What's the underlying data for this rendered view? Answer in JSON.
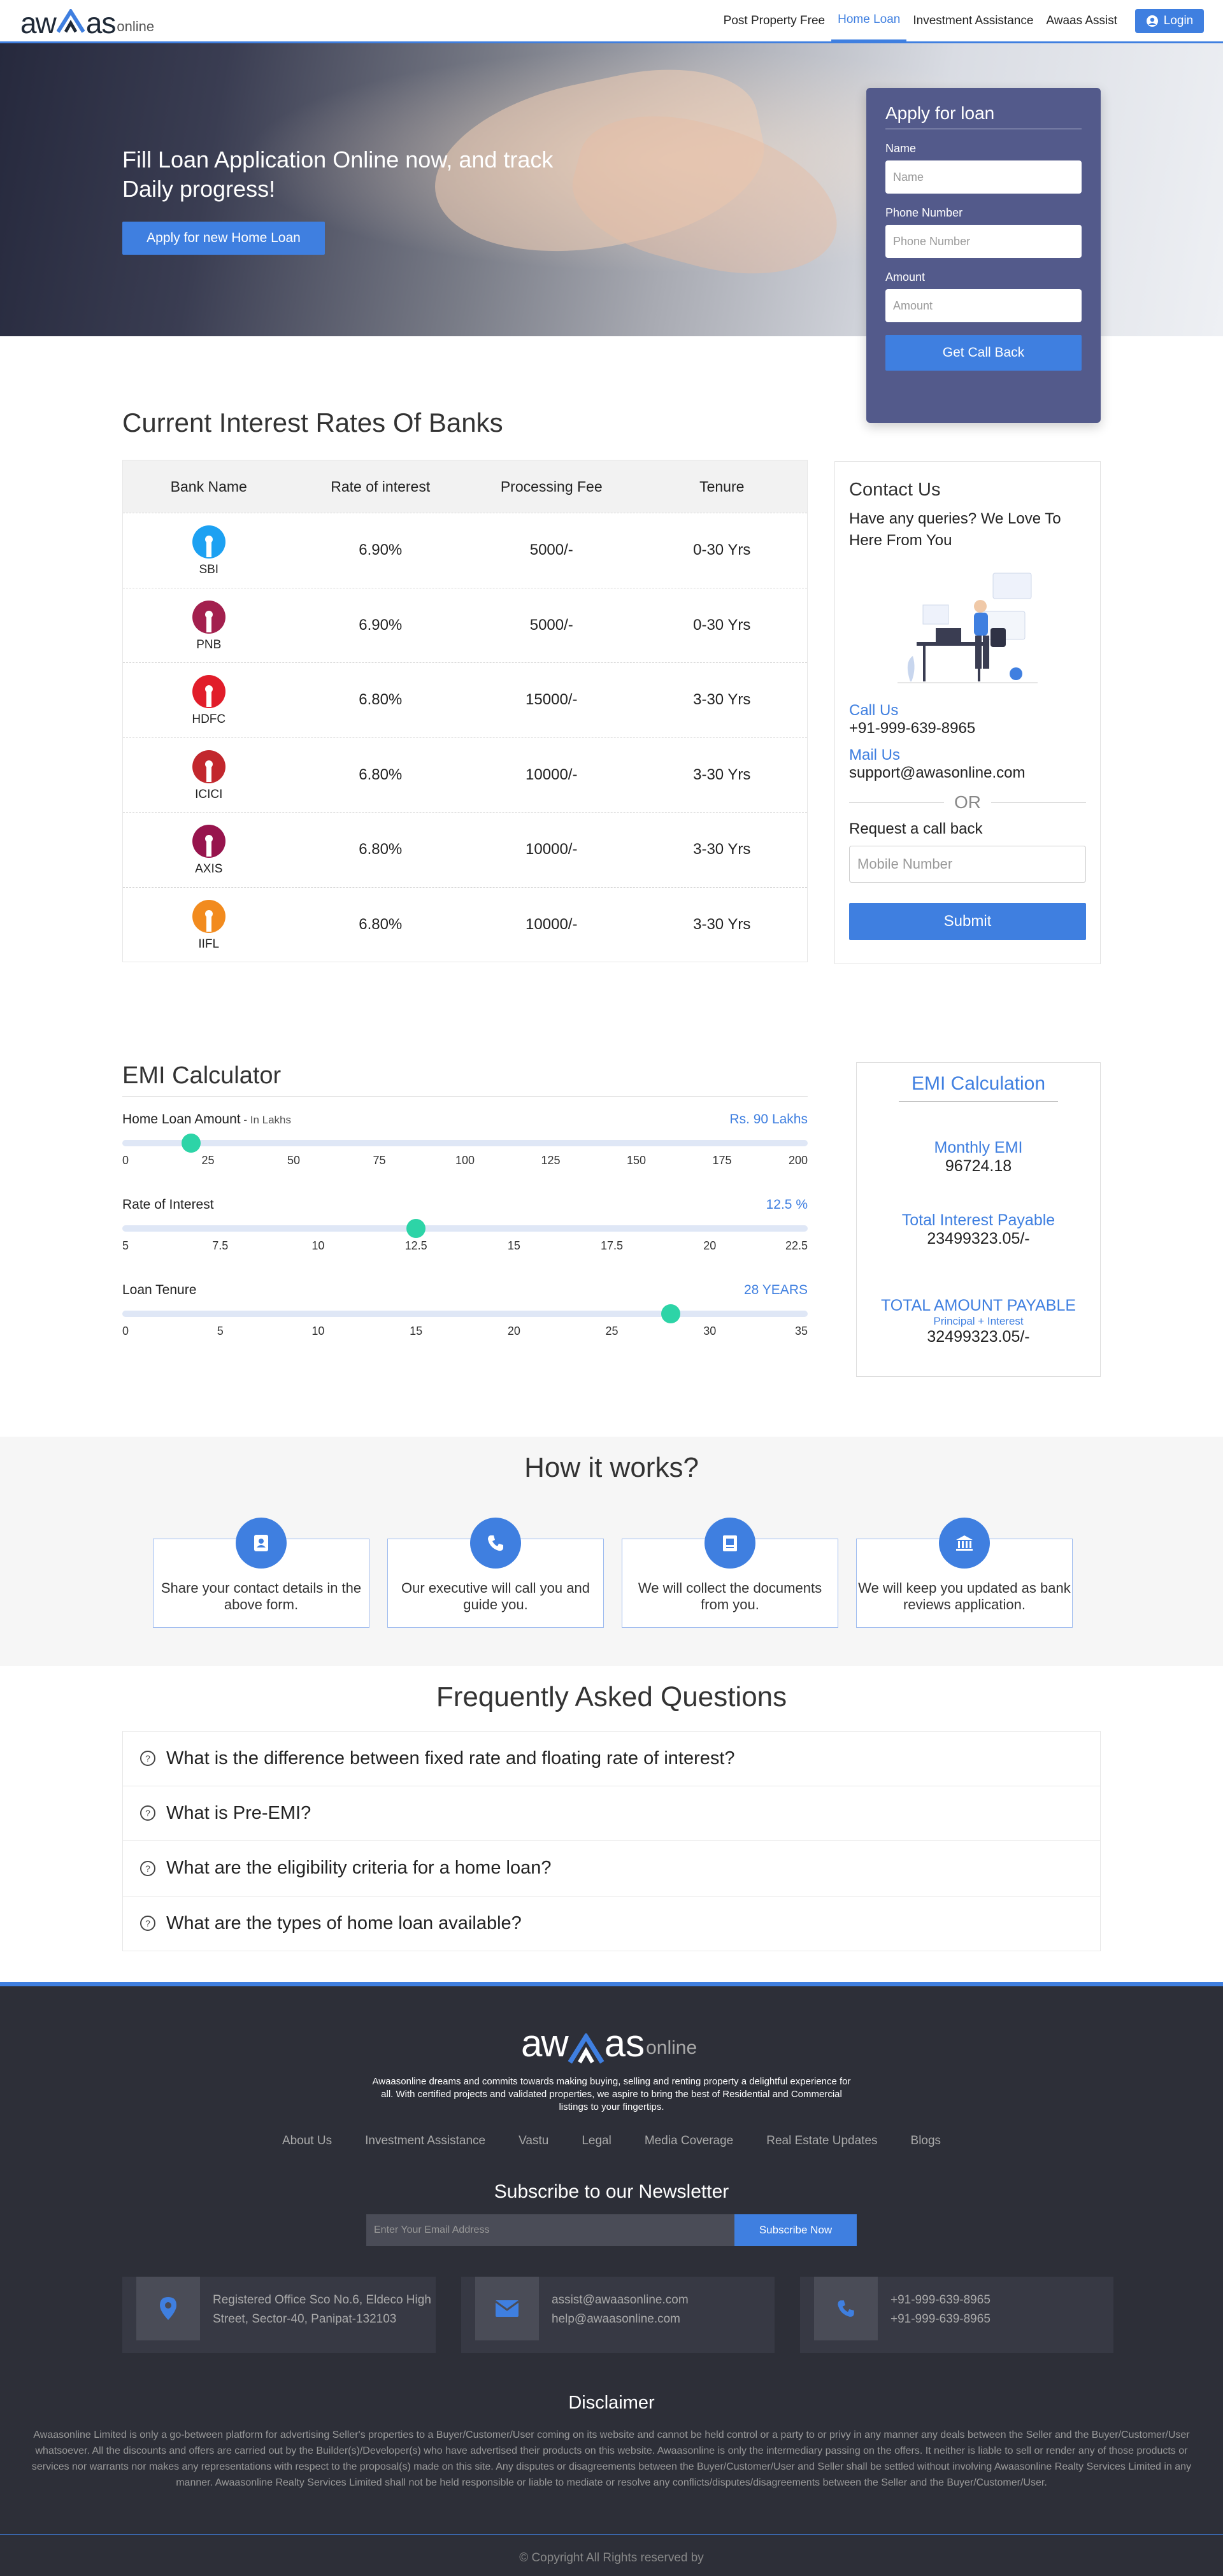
{
  "nav": {
    "logo_main": "aw  as",
    "logo_sub": "online",
    "links": [
      "Post Property Free",
      "Home Loan",
      "Investment Assistance",
      "Awaas Assist"
    ],
    "active_link": "Home Loan",
    "login_label": "Login"
  },
  "hero": {
    "title": "Fill Loan Application Online now, and track Daily progress!",
    "cta_label": "Apply for new Home Loan",
    "form": {
      "title": "Apply for loan",
      "name_label": "Name",
      "name_placeholder": "Name",
      "phone_label": "Phone Number",
      "phone_placeholder": "Phone Number",
      "amount_label": "Amount",
      "amount_placeholder": "Amount",
      "submit_label": "Get Call Back"
    }
  },
  "rates": {
    "title": "Current Interest Rates Of Banks",
    "headers": [
      "Bank Name",
      "Rate of interest",
      "Processing Fee",
      "Tenure"
    ],
    "rows": [
      {
        "bank": "SBI",
        "rate": "6.90%",
        "fee": "5000/-",
        "tenure": "0-30 Yrs",
        "color": "#1da1f2"
      },
      {
        "bank": "PNB",
        "rate": "6.90%",
        "fee": "5000/-",
        "tenure": "0-30 Yrs",
        "color": "#a3204e"
      },
      {
        "bank": "HDFC",
        "rate": "6.80%",
        "fee": "15000/-",
        "tenure": "3-30 Yrs",
        "color": "#e11d2a"
      },
      {
        "bank": "ICICI",
        "rate": "6.80%",
        "fee": "10000/-",
        "tenure": "3-30 Yrs",
        "color": "#c2272d"
      },
      {
        "bank": "AXIS",
        "rate": "6.80%",
        "fee": "10000/-",
        "tenure": "3-30 Yrs",
        "color": "#97144d"
      },
      {
        "bank": "IIFL",
        "rate": "6.80%",
        "fee": "10000/-",
        "tenure": "3-30 Yrs",
        "color": "#f28b1e"
      }
    ]
  },
  "contact": {
    "title": "Contact Us",
    "question": "Have any queries? We Love To Here From You",
    "call_label": "Call Us",
    "phone": "+91-999-639-8965",
    "mail_label": "Mail Us",
    "email": "support@awasonline.com",
    "or": "OR",
    "request_label": "Request a call back",
    "mobile_placeholder": "Mobile Number",
    "submit_label": "Submit"
  },
  "emi": {
    "title": "EMI Calculator",
    "sliders": [
      {
        "name": "Home Loan Amount",
        "hint": " - In Lakhs",
        "value": "Rs. 90 Lakhs",
        "position": 0.1,
        "ticks": [
          "0",
          "25",
          "50",
          "75",
          "100",
          "125",
          "150",
          "175",
          "200"
        ]
      },
      {
        "name": "Rate of Interest",
        "hint": "",
        "value": "12.5 %",
        "position": 0.428,
        "ticks": [
          "5",
          "7.5",
          "10",
          "12.5",
          "15",
          "17.5",
          "20",
          "22.5"
        ]
      },
      {
        "name": "Loan Tenure",
        "hint": "",
        "value": "28 YEARS",
        "position": 0.8,
        "ticks": [
          "0",
          "5",
          "10",
          "15",
          "20",
          "25",
          "30",
          "35"
        ]
      }
    ],
    "result": {
      "title": "EMI Calculation",
      "monthly_label": "Monthly EMI",
      "monthly_value": "96724.18",
      "interest_label": "Total Interest Payable",
      "interest_value": "23499323.05/-",
      "total_label": "TOTAL AMOUNT PAYABLE",
      "total_sub": "Principal + Interest",
      "total_value": "32499323.05/-"
    }
  },
  "how": {
    "title": "How it works?",
    "steps": [
      {
        "text": "Share your contact details in the above form.",
        "icon": "contact-card-icon"
      },
      {
        "text": "Our executive will call you and guide you.",
        "icon": "phone-icon"
      },
      {
        "text": "We will collect the documents from you.",
        "icon": "document-icon"
      },
      {
        "text": "We will keep you updated as bank reviews application.",
        "icon": "bank-icon"
      }
    ]
  },
  "faq": {
    "title": "Frequently Asked Questions",
    "items": [
      "What is the difference between fixed rate and floating rate of interest?",
      "What is Pre-EMI?",
      "What are the eligibility criteria for a home loan?",
      "What are the types of home loan available?"
    ]
  },
  "footer": {
    "logo_main": "aw  as",
    "logo_sub": "online",
    "description": "Awaasonline dreams and commits towards making buying, selling and renting property a delightful experience for all. With certified projects and validated properties, we aspire to bring the best of Residential and Commercial listings to your fingertips.",
    "links": [
      "About Us",
      "Investment Assistance",
      "Vastu",
      "Legal",
      "Media Coverage",
      "Real Estate Updates",
      "Blogs"
    ],
    "newsletter_title": "Subscribe to our Newsletter",
    "email_placeholder": "Enter Your Email Address",
    "subscribe_label": "Subscribe Now",
    "address": "Registered Office Sco No.6, Eldeco High Street, Sector-40, Panipat-132103",
    "emails": [
      "assist@awaasonline.com",
      "help@awaasonline.com"
    ],
    "phones": [
      "+91-999-639-8965",
      "+91-999-639-8965"
    ],
    "disclaimer_title": "Disclaimer",
    "disclaimer": "Awaasonline Limited is only a go-between platform for advertising Seller's properties to a Buyer/Customer/User coming on its website and cannot be held control or a party to or privy in any manner any deals between the Seller and the Buyer/Customer/User whatsoever. All the discounts and offers are carried out by the Builder(s)/Developer(s) who have advertised their products on this website. Awaasonline is only the intermediary passing on the offers. It neither is liable to sell or render any of those products or services nor warrants nor makes any representations with respect to the proposal(s) made on this site. Any disputes or disagreements between the Buyer/Customer/User and Seller shall be settled without involving Awaasonline Realty Services Limited in any manner. Awaasonline Realty Services Limited shall not be held responsible or liable to mediate or resolve any conflicts/disputes/disagreements between the Seller and the Buyer/Customer/User.",
    "copyright": "© Copyright All Rights reserved by"
  },
  "colors": {
    "accent": "#3f7fe0",
    "thumb": "#2dd4a7",
    "form_bg": "#535a8b",
    "footer_bg": "#2d2f38"
  }
}
